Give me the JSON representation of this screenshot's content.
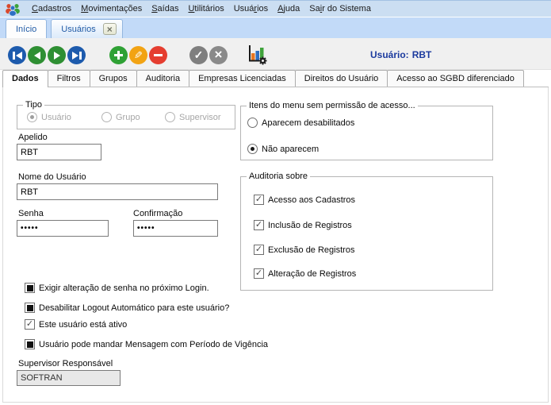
{
  "menubar": {
    "items": [
      {
        "pre": "",
        "key": "C",
        "post": "adastros"
      },
      {
        "pre": "",
        "key": "M",
        "post": "ovimentações"
      },
      {
        "pre": "",
        "key": "S",
        "post": "aídas"
      },
      {
        "pre": "",
        "key": "U",
        "post": "tilitários"
      },
      {
        "pre": "Usuá",
        "key": "r",
        "post": "ios"
      },
      {
        "pre": "",
        "key": "A",
        "post": "juda"
      },
      {
        "pre": "Sa",
        "key": "i",
        "post": "r do Sistema"
      }
    ]
  },
  "window_tabs": {
    "inicio": "Início",
    "usuarios": "Usuários",
    "close_glyph": "×"
  },
  "toolbar": {
    "icons": [
      "first-record",
      "previous-record",
      "next-record",
      "last-record",
      "add-record",
      "edit-record",
      "delete-record",
      "confirm",
      "cancel",
      "chart-settings"
    ],
    "user_label": "Usuário:",
    "user_value": "RBT"
  },
  "page_tabs": {
    "items": [
      "Dados",
      "Filtros",
      "Grupos",
      "Auditoria",
      "Empresas Licenciadas",
      "Direitos do Usuário",
      "Acesso ao SGBD diferenciado"
    ],
    "active": "Dados"
  },
  "form": {
    "tipo": {
      "legend": "Tipo",
      "options": [
        {
          "label": "Usuário",
          "state": "selected"
        },
        {
          "label": "Grupo",
          "state": "unselected"
        },
        {
          "label": "Supervisor",
          "state": "unselected"
        }
      ]
    },
    "apelido": {
      "label": "Apelido",
      "value": "RBT"
    },
    "nome_usuario": {
      "label": "Nome do Usuário",
      "value": "RBT"
    },
    "senha": {
      "label": "Senha",
      "value": "•••••"
    },
    "confirmacao": {
      "label": "Confirmação",
      "value": "•••••"
    },
    "menu_sem_permissao": {
      "legend": "Itens do menu sem permissão de acesso...",
      "options": [
        {
          "label": "Aparecem desabilitados",
          "state": "unselected"
        },
        {
          "label": "Não aparecem",
          "state": "selected"
        }
      ]
    },
    "auditoria": {
      "legend": "Auditoria sobre",
      "options": [
        {
          "label": "Acesso aos Cadastros",
          "state": "checked"
        },
        {
          "label": "Inclusão de Registros",
          "state": "checked"
        },
        {
          "label": "Exclusão de Registros",
          "state": "checked"
        },
        {
          "label": "Alteração de Registros",
          "state": "checked"
        }
      ]
    },
    "flags": [
      {
        "label": "Exigir alteração de senha no próximo Login.",
        "state": "filled"
      },
      {
        "label": "Desabilitar Logout Automático para este usuário?",
        "state": "filled"
      },
      {
        "label": "Este usuário está ativo",
        "state": "checked"
      },
      {
        "label": "Usuário pode mandar Mensagem com Período de Vigência",
        "state": "filled"
      }
    ],
    "supervisor": {
      "label": "Supervisor Responsável",
      "value": "SOFTRAN"
    }
  },
  "colors": {
    "menubar_bg": "#CBDEF2",
    "wintab_strip_bg": "#C2DAF8",
    "toolbar_bg": "#F0F0F0",
    "nav_blue": "#1D5BAD",
    "nav_green": "#2E8F33",
    "add_green": "#2FA135",
    "edit_amber": "#F2A313",
    "delete_red": "#E53E30",
    "confirm_gray": "#7F7F7F",
    "user_text_navy": "#1B3A9E",
    "wintab_text_blue": "#215BA6"
  }
}
